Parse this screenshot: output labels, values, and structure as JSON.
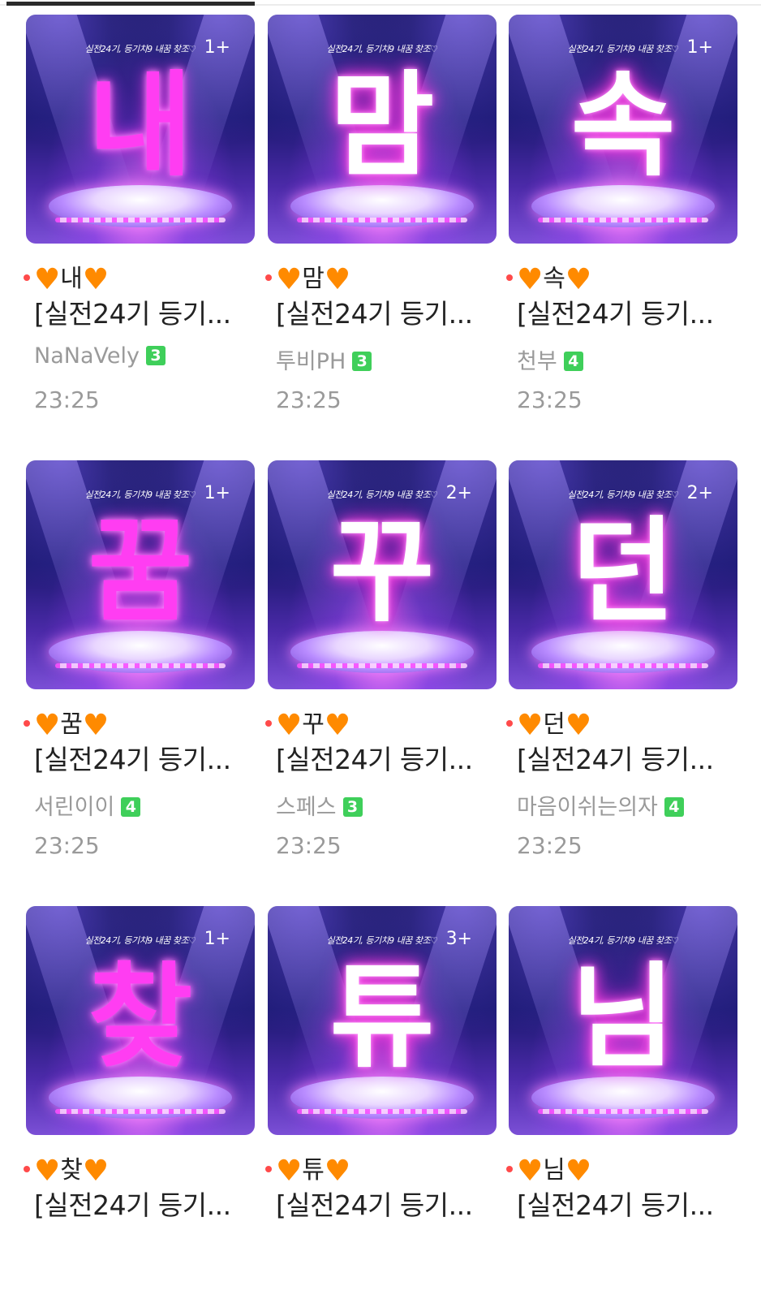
{
  "cards": [
    {
      "glyph": "내",
      "glyph_style": "pink",
      "caption": "실전24기, 등기치9 내꿈 찾조♡",
      "count": "1+",
      "title": "내",
      "subtitle": "[실전24기 등기...",
      "author": "NaNaVely",
      "level": "3",
      "time": "23:25"
    },
    {
      "glyph": "맘",
      "glyph_style": "white",
      "caption": "실전24기, 등기치9 내꿈 찾조♡",
      "count": "",
      "title": "맘",
      "subtitle": "[실전24기 등기...",
      "author": "투비PH",
      "level": "3",
      "time": "23:25"
    },
    {
      "glyph": "속",
      "glyph_style": "white",
      "caption": "실전24기, 등기치9 내꿈 찾조♡",
      "count": "1+",
      "title": "속",
      "subtitle": "[실전24기 등기...",
      "author": "천부",
      "level": "4",
      "time": "23:25"
    },
    {
      "glyph": "꿈",
      "glyph_style": "pink",
      "caption": "실전24기, 등기치9 내꿈 찾조♡",
      "count": "1+",
      "title": "꿈",
      "subtitle": "[실전24기 등기...",
      "author": "서린이이",
      "level": "4",
      "time": "23:25"
    },
    {
      "glyph": "꾸",
      "glyph_style": "white",
      "caption": "실전24기, 등기치9 내꿈 찾조♡",
      "count": "2+",
      "title": "꾸",
      "subtitle": "[실전24기 등기...",
      "author": "스페스",
      "level": "3",
      "time": "23:25"
    },
    {
      "glyph": "던",
      "glyph_style": "white",
      "caption": "실전24기, 등기치9 내꿈 찾조♡",
      "count": "2+",
      "title": "던",
      "subtitle": "[실전24기 등기...",
      "author": "마음이쉬는의자",
      "level": "4",
      "time": "23:25"
    },
    {
      "glyph": "찾",
      "glyph_style": "pink",
      "caption": "실전24기, 등기치9 내꿈 찾조♡",
      "count": "1+",
      "title": "찾",
      "subtitle": "[실전24기 등기...",
      "author": "",
      "level": "",
      "time": ""
    },
    {
      "glyph": "튜",
      "glyph_style": "white",
      "caption": "실전24기, 등기치9 내꿈 찾조♡",
      "count": "3+",
      "title": "튜",
      "subtitle": "[실전24기 등기...",
      "author": "",
      "level": "",
      "time": ""
    },
    {
      "glyph": "님",
      "glyph_style": "white",
      "caption": "실전24기, 등기치9 내꿈 찾조♡",
      "count": "",
      "title": "님",
      "subtitle": "[실전24기 등기...",
      "author": "",
      "level": "",
      "time": ""
    }
  ],
  "heart_glyph": "♥",
  "colors": {
    "heart": "#ff8a00",
    "unread_dot": "#ff4a4a",
    "level_badge": "#3fcf5a",
    "text_muted": "#9a9a9a"
  }
}
